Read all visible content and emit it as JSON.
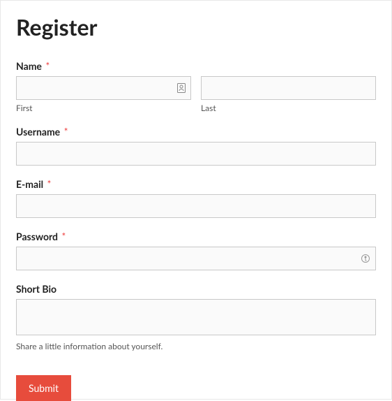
{
  "title": "Register",
  "fields": {
    "name": {
      "label": "Name",
      "required": true,
      "first_sub": "First",
      "last_sub": "Last",
      "first_value": "",
      "last_value": ""
    },
    "username": {
      "label": "Username",
      "required": true,
      "value": ""
    },
    "email": {
      "label": "E-mail",
      "required": true,
      "value": ""
    },
    "password": {
      "label": "Password",
      "required": true,
      "value": ""
    },
    "bio": {
      "label": "Short Bio",
      "required": false,
      "value": "",
      "helper": "Share a little information about yourself."
    }
  },
  "submit_label": "Submit",
  "required_marker": "*"
}
